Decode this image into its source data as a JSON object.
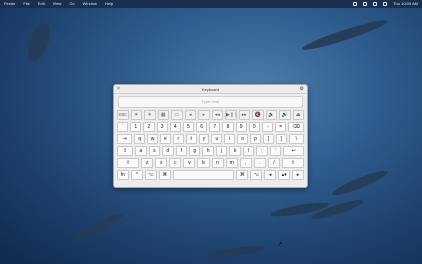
{
  "menubar": {
    "items": [
      "Finder",
      "File",
      "Edit",
      "View",
      "Go",
      "Window",
      "Help"
    ],
    "clock": "Thu 10:09 AM"
  },
  "keyboard": {
    "title": "Keyboard",
    "placeholder": "Type here",
    "rows": [
      [
        "esc",
        "☀",
        "☀",
        "▦",
        "▭",
        "◂",
        "▸",
        "◂◂",
        "▶❙❙",
        "▸▸",
        "🔇",
        "🔉",
        "🔊",
        "⏏"
      ],
      [
        "`",
        "1",
        "2",
        "3",
        "4",
        "5",
        "6",
        "7",
        "8",
        "9",
        "0",
        "-",
        "=",
        "⌫"
      ],
      [
        "⇥",
        "q",
        "w",
        "e",
        "r",
        "t",
        "y",
        "u",
        "i",
        "o",
        "p",
        "[",
        "]",
        "\\"
      ],
      [
        "⇪",
        "a",
        "s",
        "d",
        "f",
        "g",
        "h",
        "j",
        "k",
        "l",
        ";",
        "'",
        "↩"
      ],
      [
        "⇧",
        "z",
        "x",
        "c",
        "v",
        "b",
        "n",
        "m",
        ",",
        ".",
        "/",
        "⇧"
      ],
      [
        "fn",
        "^",
        "⌥",
        "⌘",
        "",
        "⌘",
        "⌥",
        "◂",
        "▴▾",
        "▸"
      ]
    ]
  }
}
